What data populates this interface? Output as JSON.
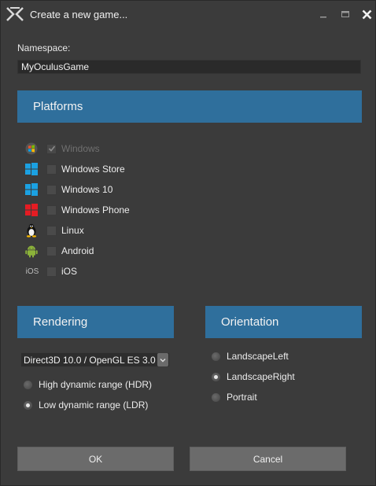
{
  "window": {
    "title": "Create a new game...",
    "logo_icon": "xenko-x-icon",
    "controls": [
      "minimize-icon",
      "maximize-icon",
      "close-icon"
    ]
  },
  "namespace": {
    "label": "Namespace:",
    "value": "MyOculusGame"
  },
  "platforms": {
    "header": "Platforms",
    "items": [
      {
        "label": "Windows",
        "icon": "windows-logo-icon",
        "checked": true,
        "enabled": false
      },
      {
        "label": "Windows Store",
        "icon": "windows-store-icon",
        "checked": false,
        "enabled": true
      },
      {
        "label": "Windows 10",
        "icon": "windows-10-icon",
        "checked": false,
        "enabled": true
      },
      {
        "label": "Windows Phone",
        "icon": "windows-phone-icon",
        "checked": false,
        "enabled": true
      },
      {
        "label": "Linux",
        "icon": "linux-tux-icon",
        "checked": false,
        "enabled": true
      },
      {
        "label": "Android",
        "icon": "android-icon",
        "checked": false,
        "enabled": true
      },
      {
        "label": "iOS",
        "icon": "ios-icon",
        "icon_text": "iOS",
        "checked": false,
        "enabled": true
      }
    ]
  },
  "rendering": {
    "header": "Rendering",
    "graphics_profile": "Direct3D 10.0 / OpenGL ES 3.0",
    "options": [
      {
        "label": "High dynamic range (HDR)",
        "checked": false
      },
      {
        "label": "Low dynamic range (LDR)",
        "checked": true
      }
    ]
  },
  "orientation": {
    "header": "Orientation",
    "options": [
      {
        "label": "LandscapeLeft",
        "checked": false
      },
      {
        "label": "LandscapeRight",
        "checked": true
      },
      {
        "label": "Portrait",
        "checked": false
      }
    ]
  },
  "buttons": {
    "ok": "OK",
    "cancel": "Cancel"
  },
  "colors": {
    "accent": "#2f6f9c",
    "windows_store": "#1ba1e2",
    "windows_phone": "#e51c23",
    "android": "#8cb33a"
  }
}
